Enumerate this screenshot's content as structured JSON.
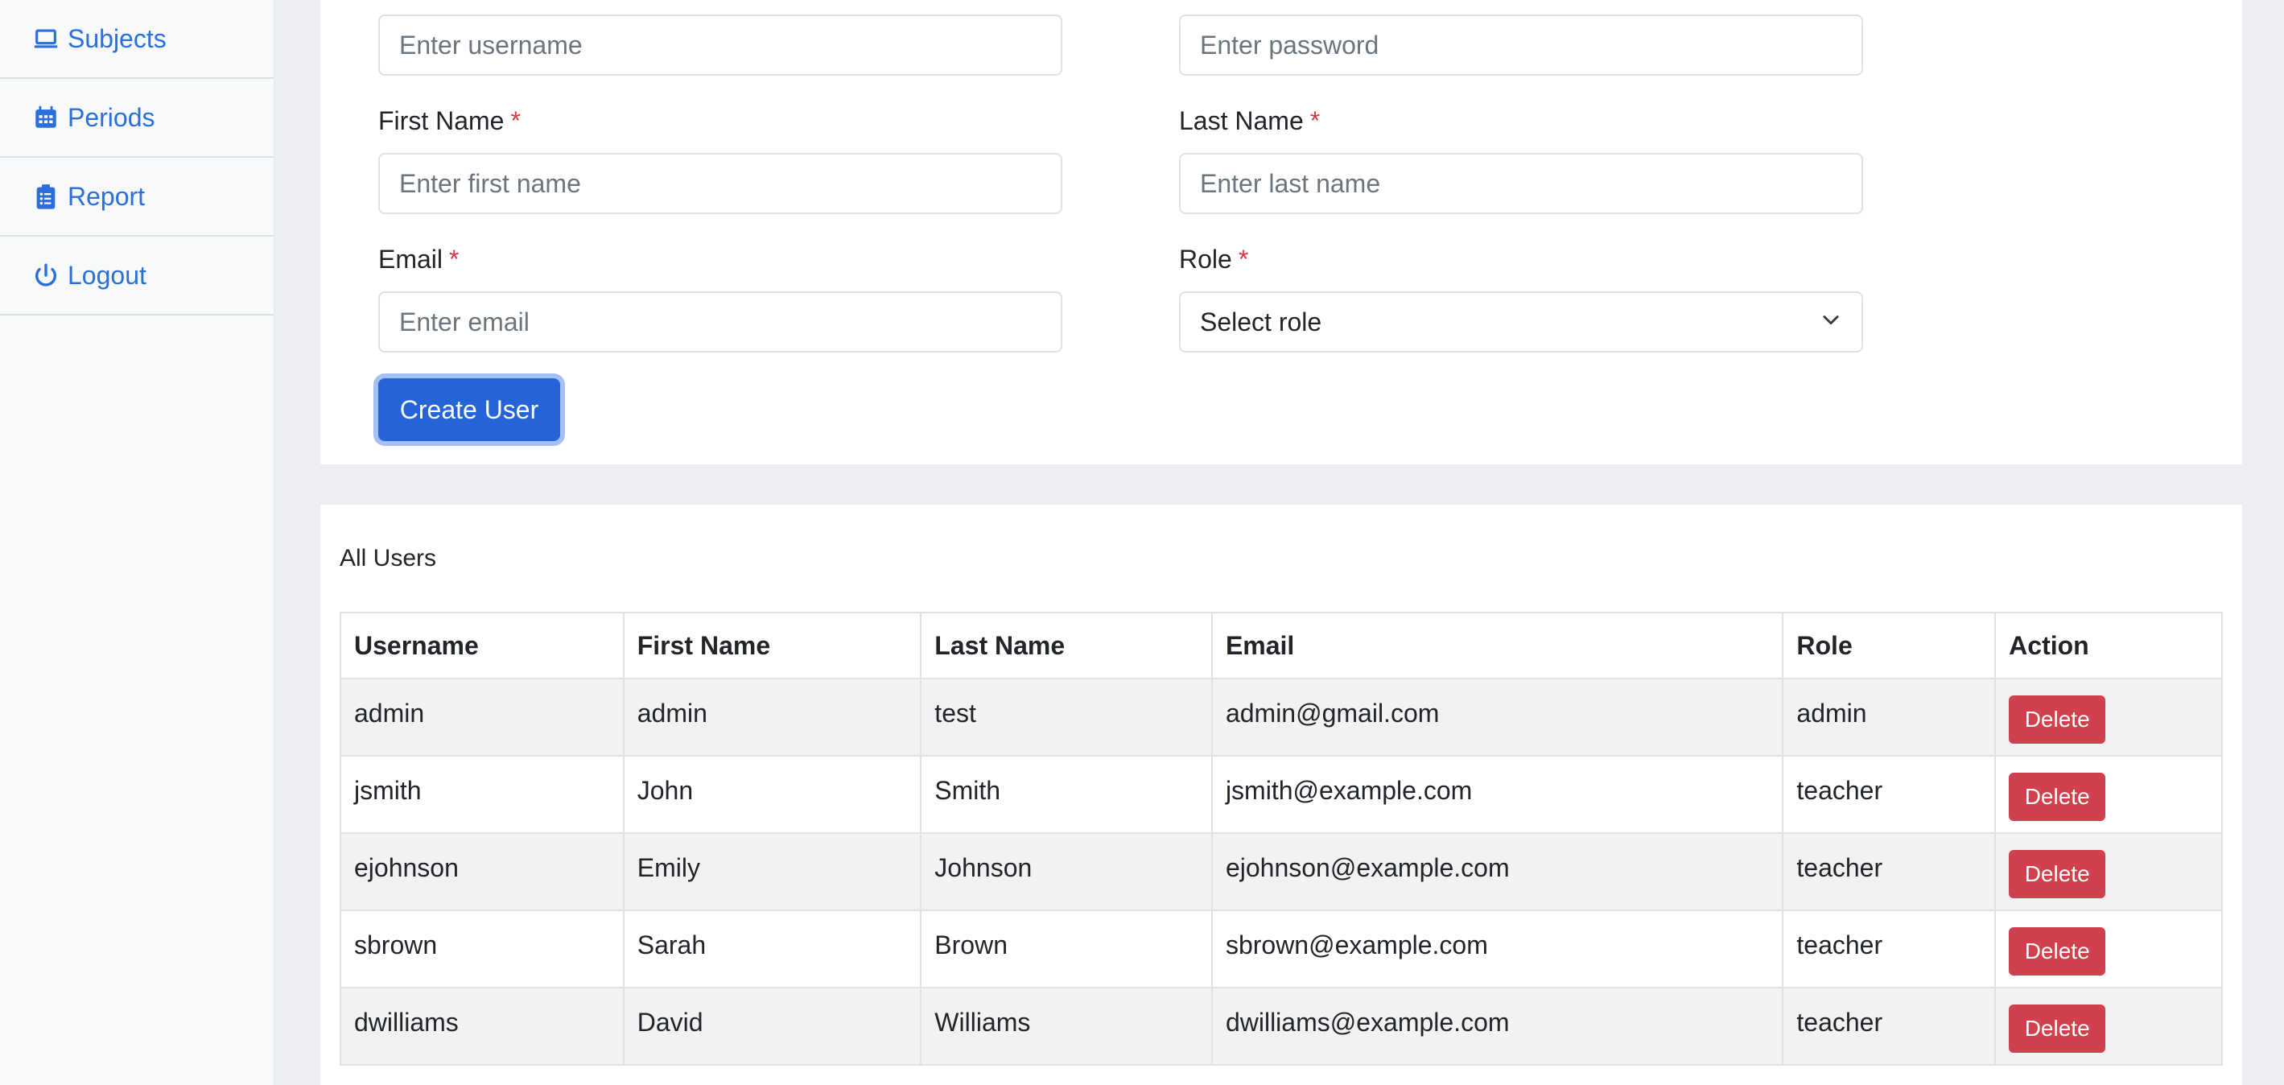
{
  "sidebar": {
    "items": [
      {
        "label": "Subjects",
        "icon": "laptop-icon"
      },
      {
        "label": "Periods",
        "icon": "calendar-icon"
      },
      {
        "label": "Report",
        "icon": "clipboard-list-icon"
      },
      {
        "label": "Logout",
        "icon": "power-icon"
      }
    ]
  },
  "form": {
    "username_placeholder": "Enter username",
    "password_placeholder": "Enter password",
    "first_name_label": "First Name",
    "first_name_placeholder": "Enter first name",
    "last_name_label": "Last Name",
    "last_name_placeholder": "Enter last name",
    "email_label": "Email",
    "email_placeholder": "Enter email",
    "role_label": "Role",
    "role_value": "Select role",
    "required_mark": "*",
    "submit_label": "Create User"
  },
  "users_table": {
    "title": "All Users",
    "headers": [
      "Username",
      "First Name",
      "Last Name",
      "Email",
      "Role",
      "Action"
    ],
    "rows": [
      [
        "admin",
        "admin",
        "test",
        "admin@gmail.com",
        "admin",
        "Delete"
      ],
      [
        "jsmith",
        "John",
        "Smith",
        "jsmith@example.com",
        "teacher",
        "Delete"
      ],
      [
        "ejohnson",
        "Emily",
        "Johnson",
        "ejohnson@example.com",
        "teacher",
        "Delete"
      ],
      [
        "sbrown",
        "Sarah",
        "Brown",
        "sbrown@example.com",
        "teacher",
        "Delete"
      ],
      [
        "dwilliams",
        "David",
        "Williams",
        "dwilliams@example.com",
        "teacher",
        "Delete"
      ]
    ]
  },
  "colors": {
    "accent": "#2a6fdb",
    "primary_button": "#2563d9",
    "danger_button": "#d1414d",
    "required": "#dc3545"
  }
}
